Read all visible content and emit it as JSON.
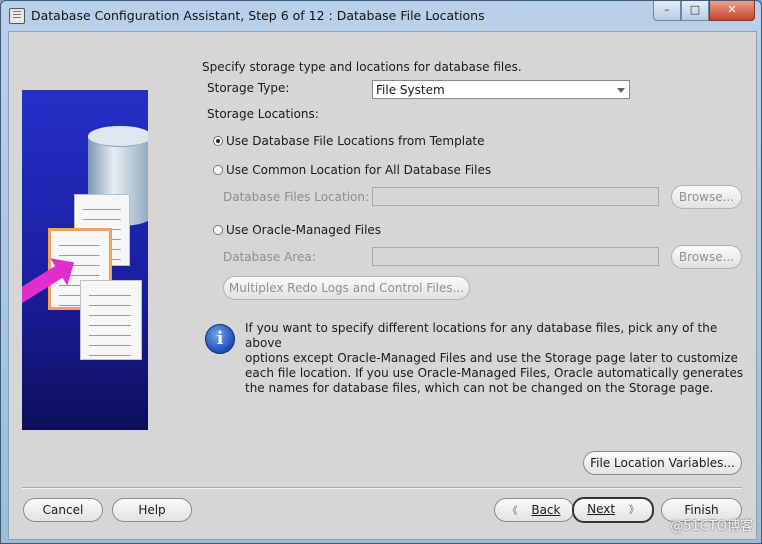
{
  "window": {
    "title": "Database Configuration Assistant, Step 6 of 12 : Database File Locations",
    "controls": {
      "minimize": "–",
      "maximize": "□",
      "close": "✕"
    }
  },
  "intro": "Specify storage type and locations for database files.",
  "storage_type": {
    "label": "Storage Type:",
    "value": "File System"
  },
  "storage_locations_label": "Storage Locations:",
  "options": {
    "template": "Use Database File Locations from Template",
    "common": "Use Common Location for All Database Files",
    "omf": "Use Oracle-Managed Files"
  },
  "common_location": {
    "label": "Database Files Location:",
    "value": "",
    "browse": "Browse..."
  },
  "database_area": {
    "label": "Database Area:",
    "value": "",
    "browse": "Browse..."
  },
  "multiplex_button": "Multiplex Redo Logs and Control Files...",
  "info_text_lines": [
    "If you want to specify different locations for any database files, pick any of the above",
    "options except Oracle-Managed Files and use the Storage page later to customize",
    "each file location. If you use Oracle-Managed Files, Oracle automatically generates",
    "the names for database files, which can not be changed on the Storage page."
  ],
  "file_location_variables": "File Location Variables...",
  "footer": {
    "cancel": "Cancel",
    "help": "Help",
    "back": "Back",
    "next": "Next",
    "finish": "Finish",
    "back_arrow": "《",
    "next_arrow": "》"
  },
  "watermark": "@51CTO博客",
  "icons": [
    "app-icon",
    "info-icon",
    "database-illustration",
    "document-illustration",
    "arrow-illustration"
  ]
}
